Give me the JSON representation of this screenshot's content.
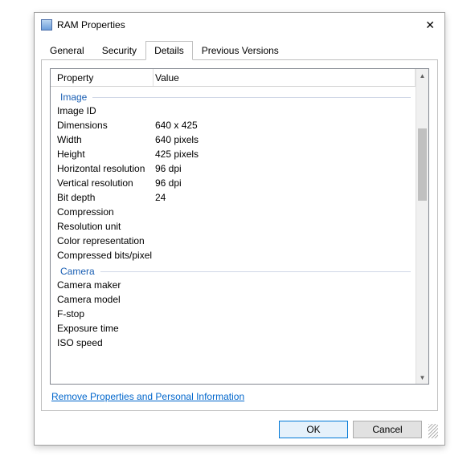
{
  "window": {
    "title": "RAM Properties"
  },
  "tabs": {
    "general": "General",
    "security": "Security",
    "details": "Details",
    "previous_versions": "Previous Versions"
  },
  "columns": {
    "property": "Property",
    "value": "Value"
  },
  "sections": {
    "image": "Image",
    "camera": "Camera"
  },
  "rows": {
    "image_id": {
      "label": "Image ID",
      "value": ""
    },
    "dimensions": {
      "label": "Dimensions",
      "value": "640 x 425"
    },
    "width": {
      "label": "Width",
      "value": "640 pixels"
    },
    "height": {
      "label": "Height",
      "value": "425 pixels"
    },
    "h_res": {
      "label": "Horizontal resolution",
      "value": "96 dpi"
    },
    "v_res": {
      "label": "Vertical resolution",
      "value": "96 dpi"
    },
    "bit_depth": {
      "label": "Bit depth",
      "value": "24"
    },
    "compression": {
      "label": "Compression",
      "value": ""
    },
    "resolution_unit": {
      "label": "Resolution unit",
      "value": ""
    },
    "color_rep": {
      "label": "Color representation",
      "value": ""
    },
    "cbpp": {
      "label": "Compressed bits/pixel",
      "value": ""
    },
    "camera_maker": {
      "label": "Camera maker",
      "value": ""
    },
    "camera_model": {
      "label": "Camera model",
      "value": ""
    },
    "f_stop": {
      "label": "F-stop",
      "value": ""
    },
    "exposure_time": {
      "label": "Exposure time",
      "value": ""
    },
    "iso_speed": {
      "label": "ISO speed",
      "value": ""
    }
  },
  "link": "Remove Properties and Personal Information",
  "buttons": {
    "ok": "OK",
    "cancel": "Cancel"
  }
}
